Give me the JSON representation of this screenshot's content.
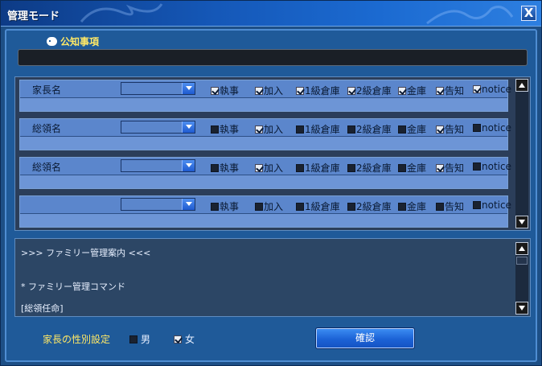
{
  "window": {
    "title": "管理モード",
    "close_label": "X"
  },
  "notice": {
    "label": "公知事項",
    "text": ""
  },
  "members": [
    {
      "rank": "家長名",
      "selected": "",
      "permissions": [
        true,
        true,
        true,
        true,
        true,
        true,
        true
      ]
    },
    {
      "rank": "総領名",
      "selected": "",
      "permissions": [
        false,
        true,
        false,
        false,
        false,
        true,
        false
      ]
    },
    {
      "rank": "総領名",
      "selected": "",
      "permissions": [
        false,
        true,
        false,
        false,
        false,
        true,
        false
      ]
    },
    {
      "rank": "",
      "selected": "",
      "permissions": [
        false,
        false,
        false,
        false,
        false,
        false,
        false
      ]
    }
  ],
  "permission_labels": [
    "執事",
    "加入",
    "1級倉庫",
    "2級倉庫",
    "金庫",
    "告知",
    "notice"
  ],
  "info": {
    "lines": [
      ">>> ファミリー管理案内 <<<",
      "",
      "* ファミリー管理コマンド",
      "[総領任命]"
    ]
  },
  "gender": {
    "label": "家長の性別設定",
    "options": [
      {
        "label": "男",
        "checked": false
      },
      {
        "label": "女",
        "checked": true
      }
    ]
  },
  "confirm": {
    "label": "確認"
  },
  "colors": {
    "accent": "#1c62d6",
    "highlight": "#ffe866",
    "panel": "#1f5a99"
  }
}
